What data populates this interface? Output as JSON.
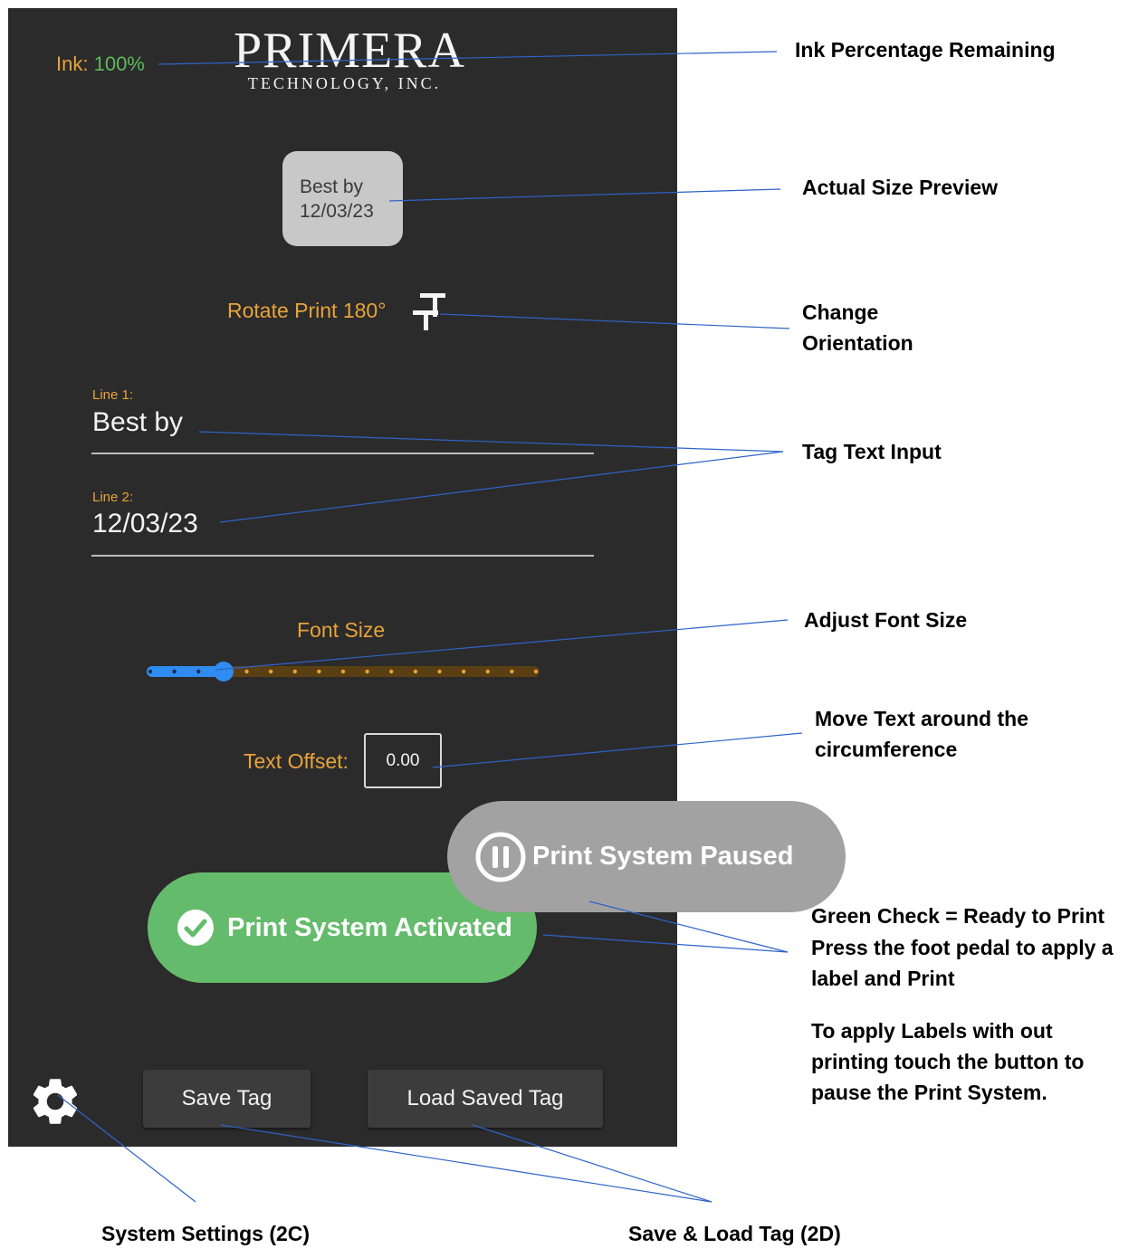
{
  "app": {
    "ink_label": "Ink:",
    "ink_value": "100%",
    "logo_main": "PRIMERA",
    "logo_sub": "TECHNOLOGY, INC.",
    "preview": {
      "line1": "Best by",
      "line2": "12/03/23"
    },
    "rotate_label": "Rotate Print 180°",
    "line1": {
      "label": "Line 1:",
      "value": "Best by"
    },
    "line2": {
      "label": "Line 2:",
      "value": "12/03/23"
    },
    "font_size": {
      "label": "Font Size",
      "steps": 17,
      "selected_step": 3,
      "fraction": 0.19
    },
    "text_offset": {
      "label": "Text Offset:",
      "value": "0.00"
    },
    "status_activated": "Print System Activated",
    "status_paused": "Print System Paused",
    "save_button": "Save Tag",
    "load_button": "Load Saved Tag",
    "settings_icon": "gear-icon",
    "colors": {
      "accent_orange": "#e8a33a",
      "ink_green": "#5cb85c",
      "activated_green": "#64bb6c",
      "paused_gray": "#a2a2a2",
      "slider_blue": "#2f8cf0",
      "panel_bg": "#2b2b2b"
    }
  },
  "callouts": {
    "ink": "Ink Percentage Remaining",
    "preview": "Actual Size Preview",
    "orientation_1": "Change",
    "orientation_2": "Orientation",
    "text_input": "Tag Text Input",
    "font_size": "Adjust Font Size",
    "offset_1": "Move Text around the",
    "offset_2": "circumference",
    "status_1": "Green Check = Ready to Print",
    "status_2": "Press the foot pedal to apply a",
    "status_3": "label and Print",
    "pause_1": "To apply Labels with out",
    "pause_2": "printing touch the button to",
    "pause_3": "pause the Print System.",
    "settings": "System Settings (2C)",
    "save_load": "Save & Load Tag (2D)"
  }
}
